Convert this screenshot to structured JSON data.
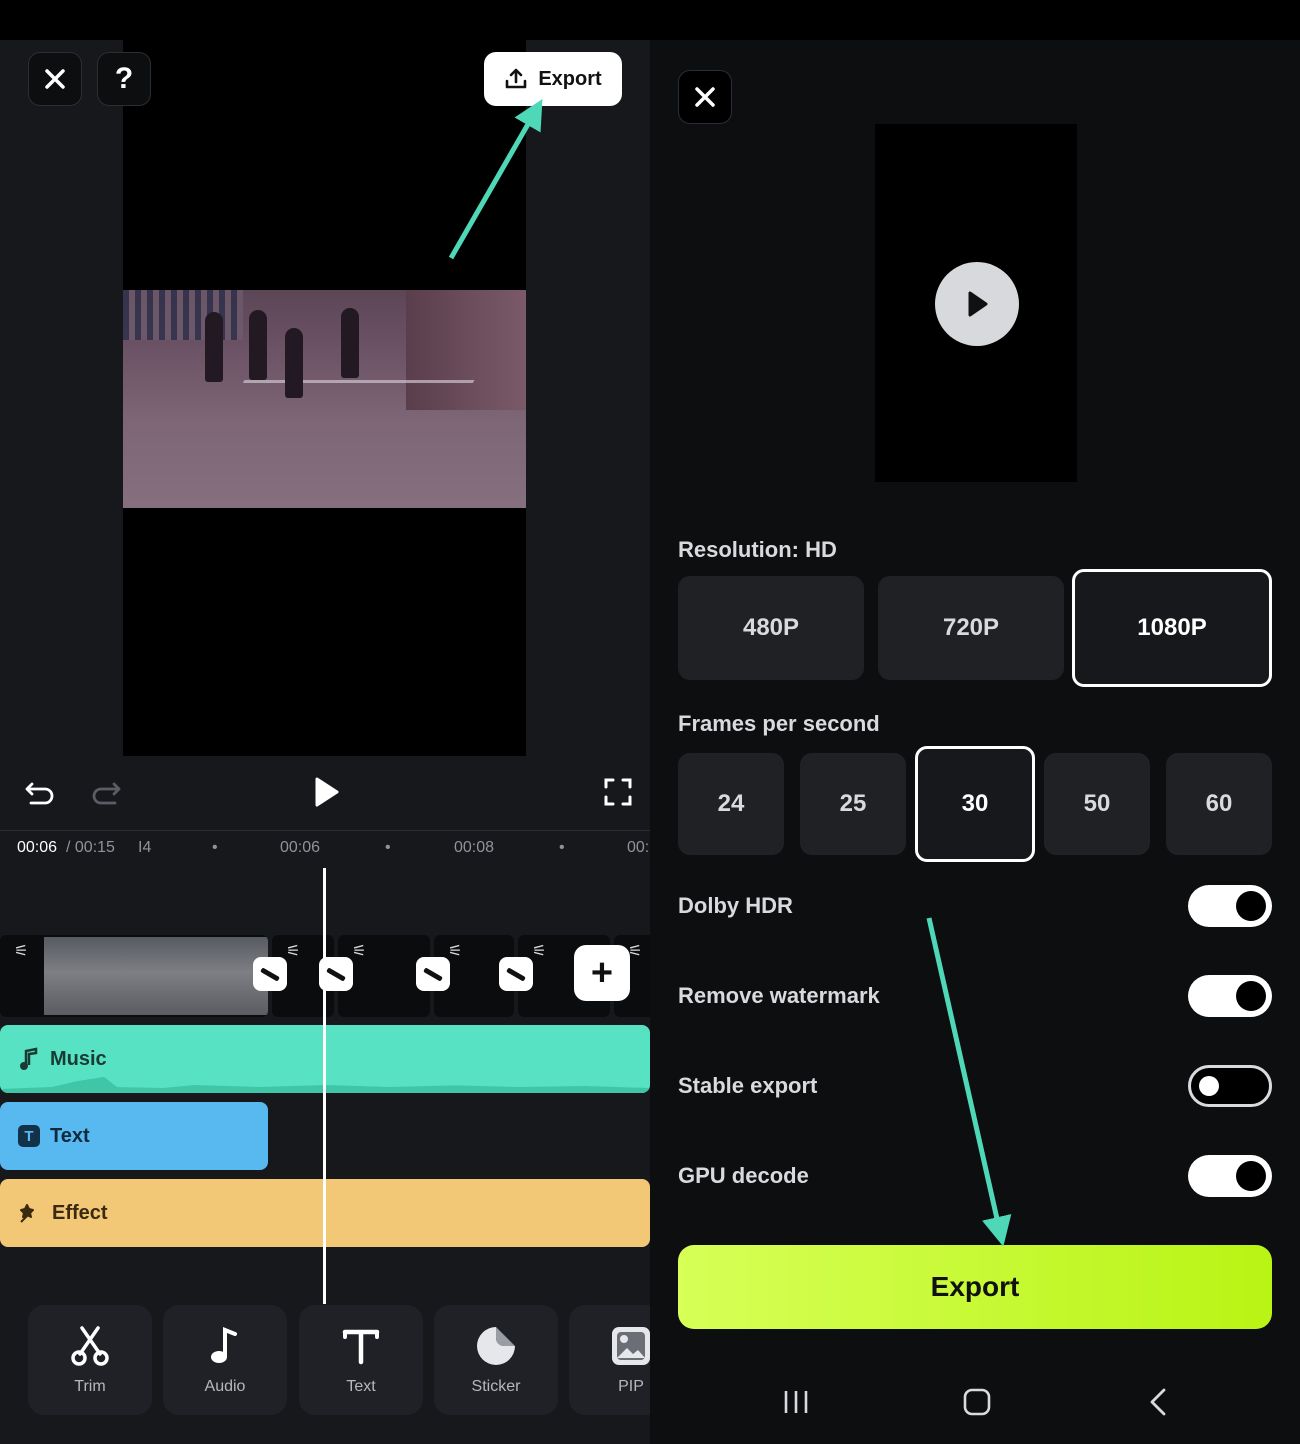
{
  "editor": {
    "close_icon": "close-icon",
    "help_label": "?",
    "export_label": "Export",
    "timecode_current": "00:06",
    "timecode_total": "/ 00:15",
    "ruler_marks": [
      "I4",
      "•",
      "00:06",
      "•",
      "00:08",
      "•",
      "00:"
    ],
    "tracks": {
      "music": "Music",
      "text": "Text",
      "effect": "Effect"
    },
    "tools": [
      {
        "label": "Trim",
        "icon": "scissors-icon"
      },
      {
        "label": "Audio",
        "icon": "music-note-icon"
      },
      {
        "label": "Text",
        "icon": "text-t-icon"
      },
      {
        "label": "Sticker",
        "icon": "sticker-icon"
      },
      {
        "label": "PIP",
        "icon": "image-icon"
      }
    ],
    "add_label": "+"
  },
  "export_panel": {
    "resolution_title": "Resolution: HD",
    "resolutions": [
      "480P",
      "720P",
      "1080P"
    ],
    "selected_resolution": "1080P",
    "fps_title": "Frames per second",
    "fps_options": [
      "24",
      "25",
      "30",
      "50",
      "60"
    ],
    "selected_fps": "30",
    "toggles": [
      {
        "label": "Dolby HDR",
        "on": true
      },
      {
        "label": "Remove watermark",
        "on": true
      },
      {
        "label": "Stable export",
        "on": false
      },
      {
        "label": "GPU decode",
        "on": true
      }
    ],
    "export_button": "Export"
  },
  "colors": {
    "accent": "#b8f414",
    "annotation_arrow": "#4fd8b8",
    "music_track": "#57e2c3",
    "text_track": "#57b9f0",
    "effect_track": "#f2c877"
  }
}
